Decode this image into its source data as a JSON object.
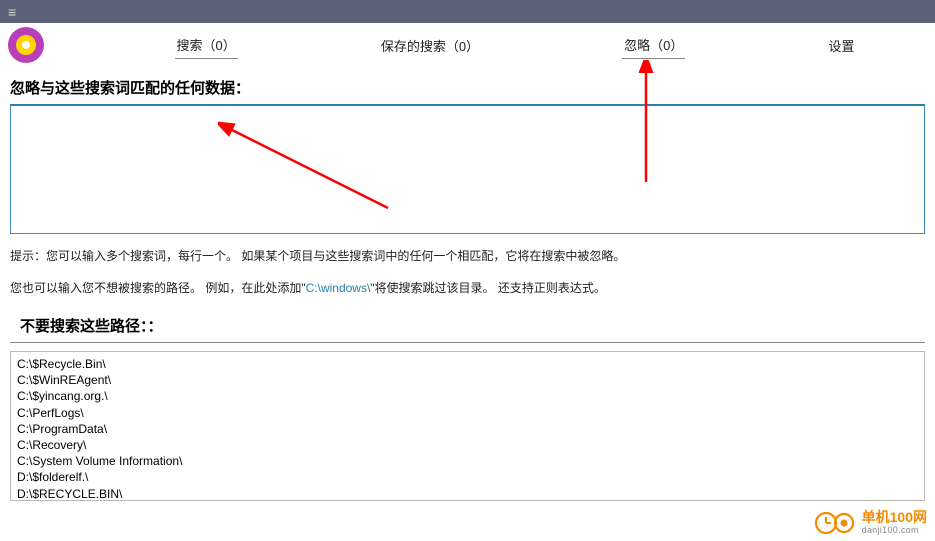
{
  "titlebar": {
    "menu_glyph": "≡"
  },
  "tabs": [
    {
      "label": "搜索（0）",
      "active": true
    },
    {
      "label": "保存的搜索（0）",
      "active": false
    },
    {
      "label": "忽略（0）",
      "active": true
    },
    {
      "label": "设置",
      "active": false
    }
  ],
  "section1": {
    "title": "忽略与这些搜索词匹配的任何数据：",
    "value": ""
  },
  "hint": {
    "line1": "提示：您可以输入多个搜索词，每行一个。 如果某个项目与这些搜索词中的任何一个相匹配，它将在搜索中被忽略。",
    "line2_a": "您也可以输入您不想被搜索的路径。 例如，在此处添加\"",
    "line2_path": "C:\\windows\\",
    "line2_b": "\"将使搜索跳过该目录。 还支持正则表达式。"
  },
  "section2": {
    "title": "不要搜索这些路径：：",
    "paths": "C:\\$Recycle.Bin\\\nC:\\$WinREAgent\\\nC:\\$yincang.org.\\\nC:\\PerfLogs\\\nC:\\ProgramData\\\nC:\\Recovery\\\nC:\\System Volume Information\\\nD:\\$folderelf.\\\nD:\\$RECYCLE.BIN\\\nD:\\$yincang.org.\\"
  },
  "watermark": {
    "cn": "单机100网",
    "en": "danji100.com"
  },
  "colors": {
    "arrow": "#ff0000",
    "titlebar": "#5a6278",
    "logo_outer": "#b93fb9",
    "logo_mid": "#ffd400"
  }
}
